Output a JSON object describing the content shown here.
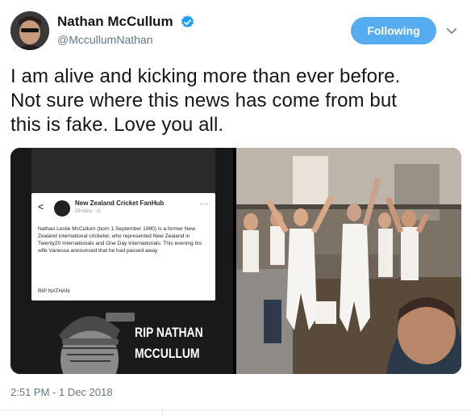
{
  "tweet": {
    "display_name": "Nathan McCullum",
    "handle": "@MccullumNathan",
    "follow_label": "Following",
    "text_lines": [
      "I am alive and kicking more than ever before.",
      "Not sure where this news has come from but",
      "this is fake. Love you all."
    ],
    "timestamp": "2:51 PM - 1 Dec 2018"
  },
  "media": {
    "screenshot": {
      "back_glyph": "<",
      "page_name": "New Zealand Cricket FanHub",
      "time": "29 mins · ◷",
      "more_glyph": "...",
      "body": "Nathan Leslie McCullum (born 1 September 1980) is a former New Zealand international cricketer, who represented New Zealand in Twenty20 Internationals and One Day Internationals. This evening his wife Vanessa announced that he had passed away",
      "rip_line": "RIP NATHAN",
      "caption_lines": [
        "RIP NATHAN",
        "MCCULLUM"
      ]
    },
    "photo": {
      "kind": "party-selfie"
    }
  },
  "icons": {
    "verified": "verified-badge-icon",
    "menu": "chevron-down-icon"
  },
  "colors": {
    "accent": "#55acee",
    "verified": "#1da1f2",
    "secondary_text": "#657786",
    "divider": "#e6ecf0"
  }
}
